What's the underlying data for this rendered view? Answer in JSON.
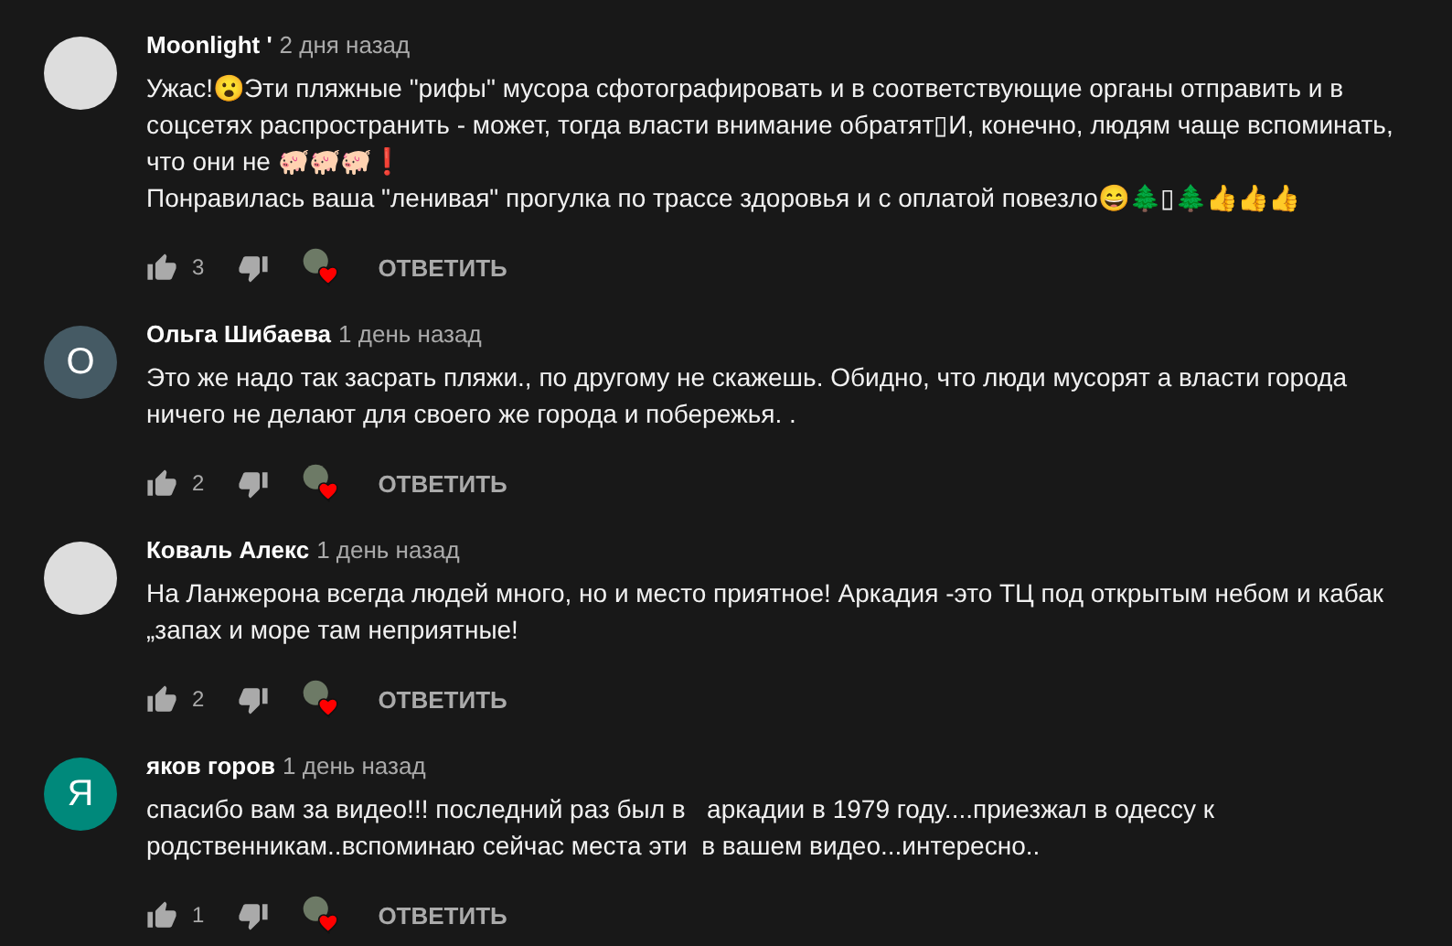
{
  "comments": [
    {
      "author": "Moonlight '",
      "time": "2 дня назад",
      "avatar": {
        "kind": "photo"
      },
      "paragraphs": [
        "Ужас!😮Эти пляжные \"рифы\" мусора сфотографировать и в соответствующие органы отправить и в соцсетях распространить - может, тогда власти внимание обратят▯И, конечно, людям чаще вспоминать, что они не 🐖🐖🐖❗",
        "Понравилась ваша \"ленивая\" прогулка по трассе здоровья и с оплатой повезло😄🌲▯🌲👍👍👍"
      ],
      "likes": "3",
      "hearted": true,
      "reply": "ОТВЕТИТЬ"
    },
    {
      "author": "Ольга Шибаева",
      "time": "1 день назад",
      "avatar": {
        "kind": "letter",
        "letter": "О",
        "color": "#455a64"
      },
      "paragraphs": [
        "Это же надо так засрать пляжи., по другому не скажешь. Обидно, что люди мусорят а власти города ничего не делают для своего же города и побережья. ."
      ],
      "likes": "2",
      "hearted": true,
      "reply": "ОТВЕТИТЬ"
    },
    {
      "author": "Коваль Алекс",
      "time": "1 день назад",
      "avatar": {
        "kind": "photo"
      },
      "paragraphs": [
        "На Ланжерона всегда людей много, но и место приятное! Аркадия -это ТЦ под открытым небом и кабак „запах и море там неприятные!"
      ],
      "likes": "2",
      "hearted": true,
      "reply": "ОТВЕТИТЬ"
    },
    {
      "author": "яков горов",
      "time": "1 день назад",
      "avatar": {
        "kind": "letter",
        "letter": "Я",
        "color": "#00897b"
      },
      "paragraphs": [
        "спасибо вам за видео!!! последний раз был в   аркадии в 1979 году....приезжал в одессу к родственникам..вспоминаю сейчас места эти  в вашем видео...интересно.."
      ],
      "likes": "1",
      "hearted": true,
      "reply": "ОТВЕТИТЬ"
    }
  ]
}
